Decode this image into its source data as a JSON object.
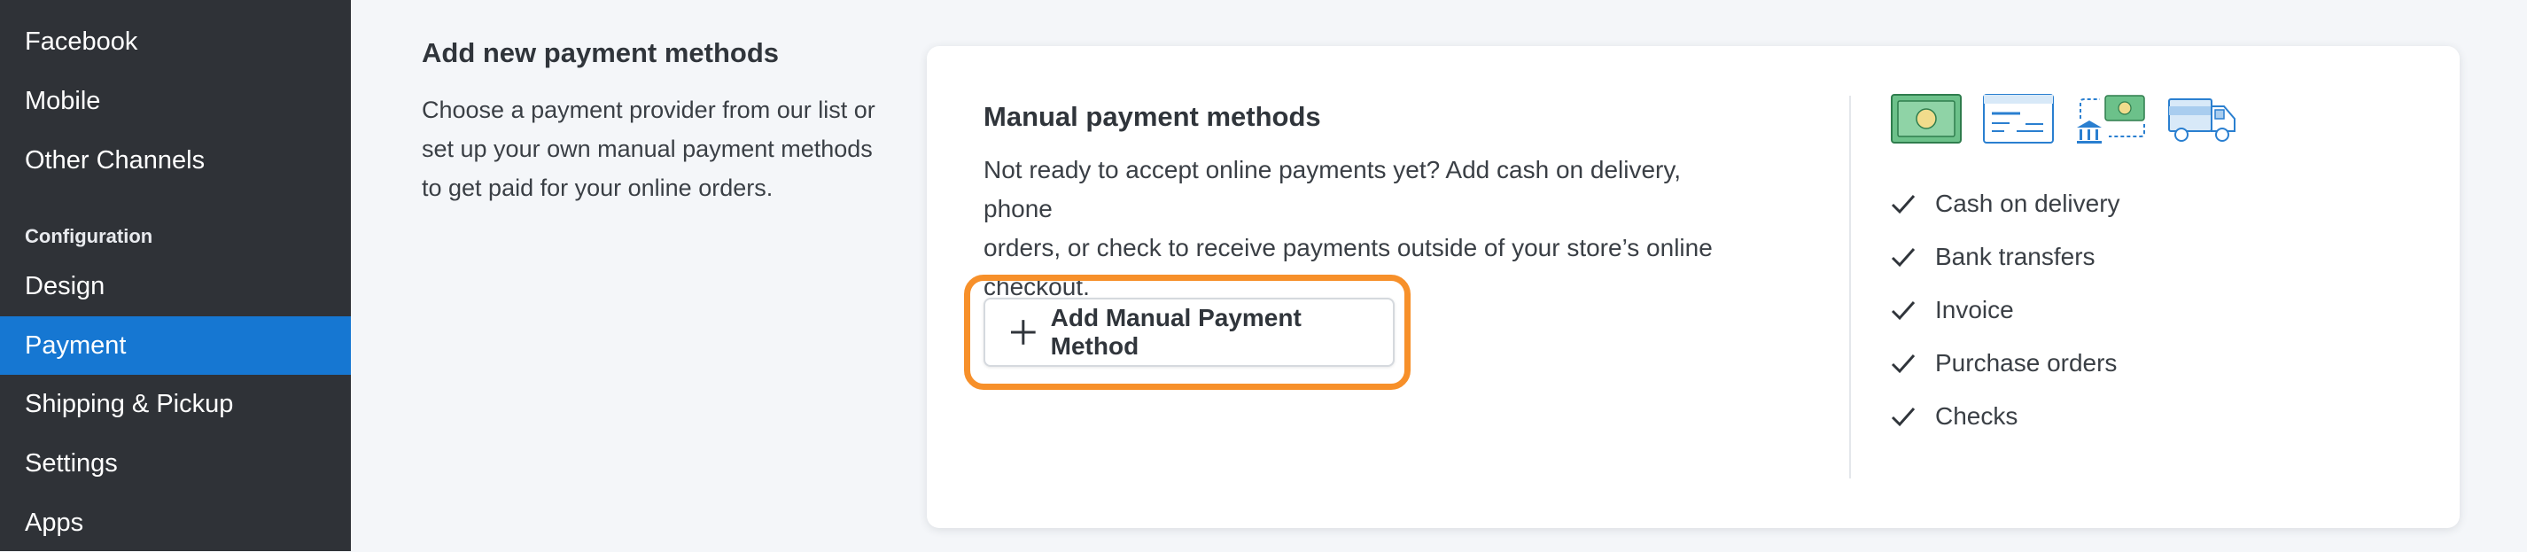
{
  "sidebar": {
    "items": [
      {
        "label": "Facebook",
        "active": false
      },
      {
        "label": "Mobile",
        "active": false
      },
      {
        "label": "Other Channels",
        "active": false
      }
    ],
    "section_label": "Configuration",
    "config_items": [
      {
        "label": "Design",
        "active": false
      },
      {
        "label": "Payment",
        "active": true
      },
      {
        "label": "Shipping & Pickup",
        "active": false
      },
      {
        "label": "Settings",
        "active": false
      },
      {
        "label": "Apps",
        "active": false
      }
    ]
  },
  "section": {
    "title": "Add new payment methods",
    "description_lines": [
      "Choose a payment provider from our list or",
      "set up your own manual payment methods",
      "to get paid for your online orders."
    ]
  },
  "card": {
    "title": "Manual payment methods",
    "description_lines": [
      "Not ready to accept online payments yet? Add cash on delivery, phone",
      "orders, or check to receive payments outside of your store’s online",
      "checkout."
    ],
    "add_button_label": "Add Manual Payment Method",
    "icons": [
      "cash-icon",
      "check-document-icon",
      "bank-transfer-icon",
      "delivery-truck-icon"
    ],
    "features": [
      "Cash on delivery",
      "Bank transfers",
      "Invoice",
      "Purchase orders",
      "Checks"
    ]
  },
  "colors": {
    "sidebar_bg": "#2f3237",
    "active_item": "#1677d2",
    "highlight": "#f7902a",
    "icon_green": "#5bb37a",
    "icon_blue": "#2a7fd0"
  }
}
